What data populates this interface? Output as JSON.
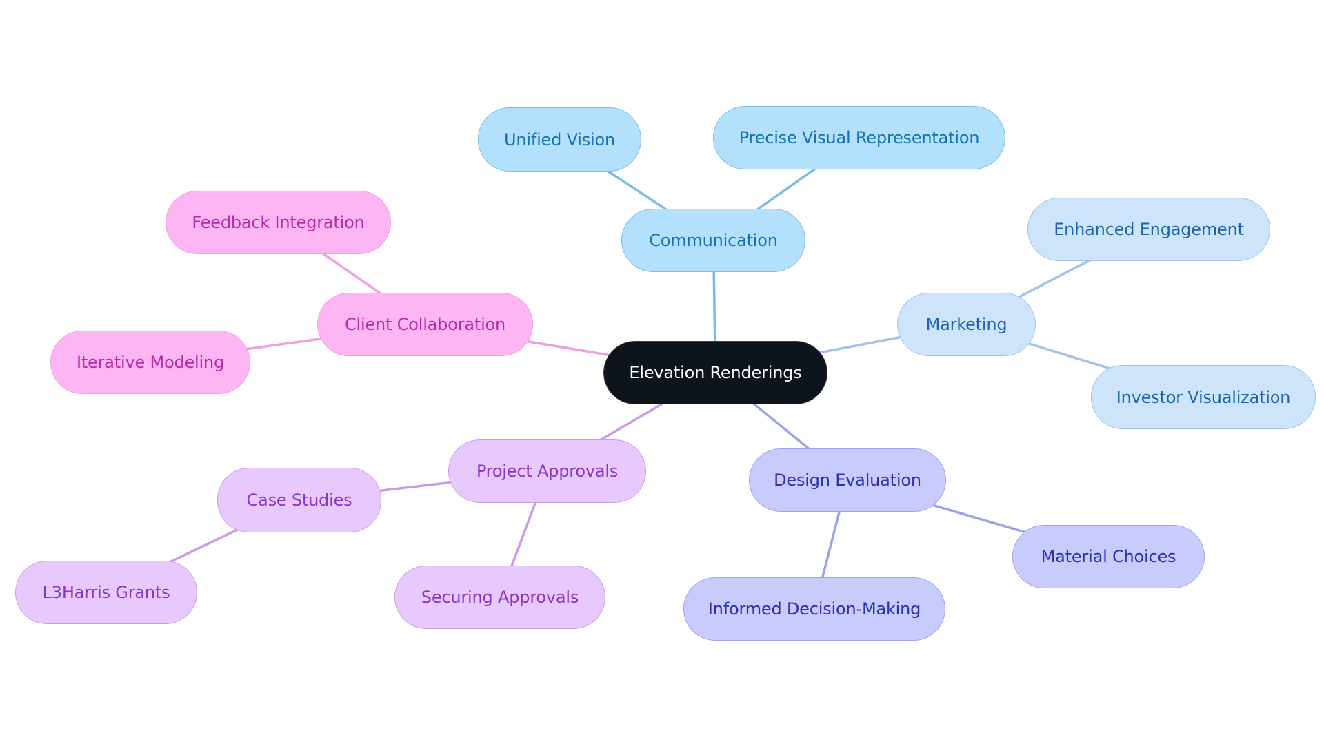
{
  "diagram": {
    "type": "mindmap",
    "root": {
      "id": "root",
      "label": "Elevation Renderings"
    },
    "branches": [
      {
        "id": "communication",
        "label": "Communication",
        "theme": "t-comm",
        "edge_color": "#7dbbe5",
        "children": [
          {
            "id": "unified-vision",
            "label": "Unified Vision"
          },
          {
            "id": "precise-visual-representation",
            "label": "Precise Visual Representation"
          }
        ]
      },
      {
        "id": "marketing",
        "label": "Marketing",
        "theme": "t-mkt",
        "edge_color": "#9fc3ea",
        "children": [
          {
            "id": "enhanced-engagement",
            "label": "Enhanced Engagement"
          },
          {
            "id": "investor-visualization",
            "label": "Investor Visualization"
          }
        ]
      },
      {
        "id": "client-collaboration",
        "label": "Client Collaboration",
        "theme": "t-client",
        "edge_color": "#ee9fe2",
        "children": [
          {
            "id": "feedback-integration",
            "label": "Feedback Integration"
          },
          {
            "id": "iterative-modeling",
            "label": "Iterative Modeling"
          }
        ]
      },
      {
        "id": "project-approvals",
        "label": "Project Approvals",
        "theme": "t-proj",
        "edge_color": "#cc9be8",
        "children": [
          {
            "id": "case-studies",
            "label": "Case Studies",
            "children": [
              {
                "id": "l3harris-grants",
                "label": "L3Harris Grants"
              }
            ]
          },
          {
            "id": "securing-approvals",
            "label": "Securing Approvals"
          }
        ]
      },
      {
        "id": "design-evaluation",
        "label": "Design Evaluation",
        "theme": "t-design",
        "edge_color": "#9ca2ea",
        "children": [
          {
            "id": "material-choices",
            "label": "Material Choices"
          },
          {
            "id": "informed-decision-making",
            "label": "Informed Decision-Making"
          }
        ]
      }
    ]
  }
}
